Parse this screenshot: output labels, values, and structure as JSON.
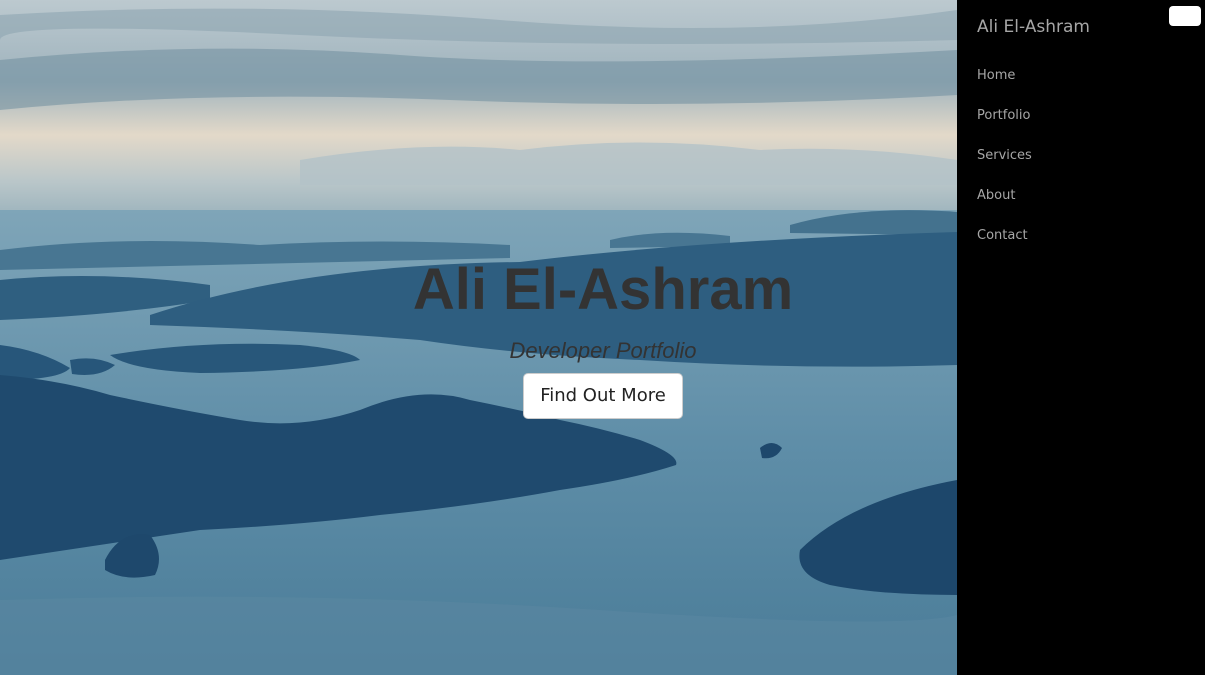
{
  "hero": {
    "title": "Ali El-Ashram",
    "subtitle": "Developer Portfolio",
    "button_label": "Find Out More"
  },
  "sidebar": {
    "brand": "Ali El-Ashram",
    "items": [
      {
        "label": "Home"
      },
      {
        "label": "Portfolio"
      },
      {
        "label": "Services"
      },
      {
        "label": "About"
      },
      {
        "label": "Contact"
      }
    ]
  },
  "colors": {
    "sidebar_bg": "#000000",
    "nav_text": "#a6a6a6",
    "hero_text": "#333333",
    "button_bg": "#ffffff"
  },
  "icons": {
    "menu_toggle": "menu-toggle-icon"
  }
}
